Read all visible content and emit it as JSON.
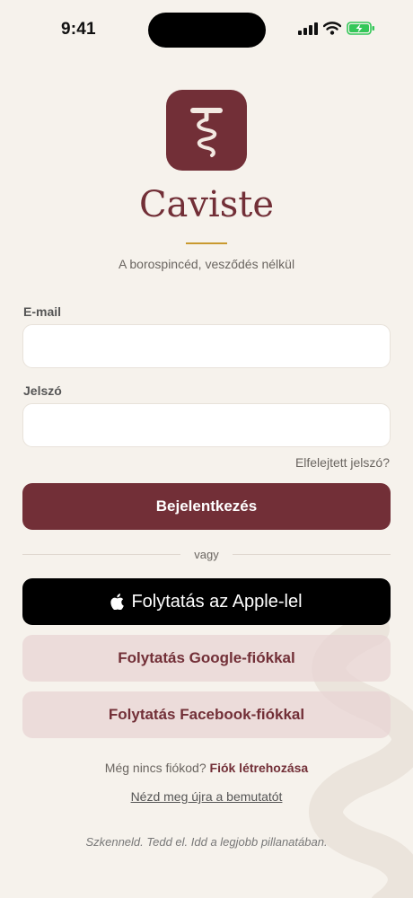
{
  "status_bar": {
    "time": "9:41",
    "icons": [
      "signal-icon",
      "wifi-icon",
      "battery-charging-icon"
    ],
    "battery_color": "#34c759"
  },
  "brand": {
    "app_name": "Caviste",
    "tagline": "A borospincéd, vesződés nélkül",
    "icon": "corkscrew-icon",
    "primary_color": "#722f37",
    "accent_color": "#c9992f",
    "background_color": "#f6f2ec"
  },
  "form": {
    "email_label": "E-mail",
    "email_value": "",
    "password_label": "Jelszó",
    "password_value": "",
    "forgot_password": "Elfelejtett jelszó?",
    "login_button": "Bejelentkezés"
  },
  "divider": {
    "label": "vagy"
  },
  "social": {
    "apple_icon": "apple-icon",
    "apple_label": "Folytatás az Apple-lel",
    "google_label": "Folytatás Google-fiókkal",
    "facebook_label": "Folytatás Facebook-fiókkal"
  },
  "footer": {
    "no_account_text": "Még nincs fiókod?",
    "create_account_link": "Fiók létrehozása",
    "demo_link": "Nézd meg újra a bemutatót",
    "slogan": "Szkenneld. Tedd el. Idd a legjobb pillanatában."
  }
}
